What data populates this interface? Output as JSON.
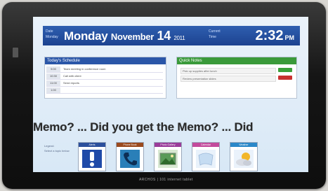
{
  "header": {
    "left_small_1": "Monday",
    "left_small_2": "Date",
    "weekday": "Monday",
    "month": "November",
    "day": "14",
    "year": "2011",
    "right_small_1": "Current",
    "right_small_2": "Time",
    "time": "2:32",
    "ampm": "PM"
  },
  "schedule": {
    "title": "Today's Schedule",
    "rows": [
      {
        "time": "9:00",
        "text": "Team meeting in conference room"
      },
      {
        "time": "10:30",
        "text": "Call with client"
      },
      {
        "time": "11:00",
        "text": "Send reports"
      },
      {
        "time": "1:00",
        "text": ""
      }
    ]
  },
  "notes": {
    "title": "Quick Notes",
    "items": [
      "Pick up supplies after lunch",
      "Review presentation slides"
    ]
  },
  "memo": "Memo? ... Did you get the Memo? ... Did",
  "legend": [
    "Legend:",
    "Select a topic below"
  ],
  "tiles": [
    {
      "label": "Alerts",
      "icon": "exclamation-icon",
      "color": "#2b4f9c"
    },
    {
      "label": "Phone Book",
      "icon": "phone-icon",
      "color": "#9a4a1e"
    },
    {
      "label": "Photo Gallery",
      "icon": "picture-icon",
      "color": "#9a3c9a"
    },
    {
      "label": "Calendar",
      "icon": "paper-icon",
      "color": "#c34b9c"
    },
    {
      "label": "Weather",
      "icon": "sun-cloud-icon",
      "color": "#2b88c9"
    }
  ],
  "brand": "ARCHOS | 101 internet tablet",
  "colors": {
    "header_blue": "#1c4290",
    "schedule_header": "#2a56a8",
    "notes_header": "#3a9a3a",
    "note_button_green": "#3aa03a",
    "note_button_red": "#c83030"
  }
}
